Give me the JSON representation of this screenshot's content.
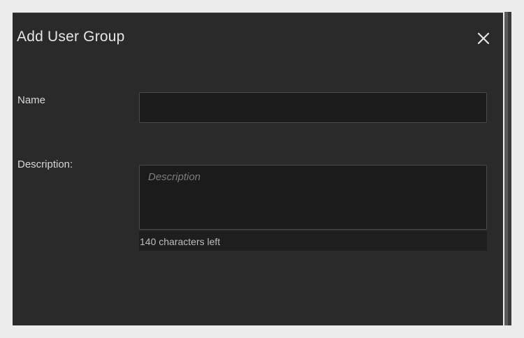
{
  "dialog": {
    "title": "Add User Group",
    "close_icon": "close-icon"
  },
  "form": {
    "name_label": "Name",
    "name_value": "",
    "description_label": "Description:",
    "description_placeholder": "Description",
    "description_value": "",
    "characters_left": "140 characters left"
  },
  "colors": {
    "page_background": "#ececec",
    "dialog_background": "#2a2a2a",
    "field_background": "#1b1b1b",
    "field_border": "#4a4a4a",
    "text": "#e6e6e6"
  }
}
